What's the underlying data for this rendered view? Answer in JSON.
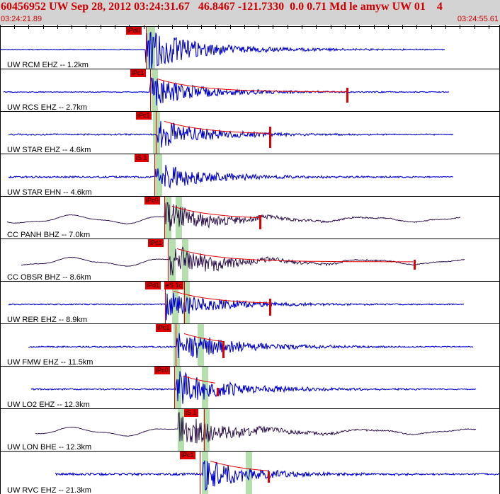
{
  "header": {
    "title": "60456952 UW Sep 28, 2012 03:24:31.67   46.8467 -121.7330  0.0 0.71 Md le amyw UW 01    4",
    "start_time": "03:24:21.89",
    "end_time": "03:24:55.61"
  },
  "colors": {
    "header_bg": "#d3d3d3",
    "header_text": "#cc0000",
    "trace_blue": "#0000cc",
    "trace_dark": "#200040",
    "pick_red": "#e00000",
    "window_green": "#a8dba0"
  },
  "traces": [
    {
      "label": "UW RCM EHZ -- 1.2km",
      "picks": [
        "iPd0"
      ],
      "color": "blue"
    },
    {
      "label": "UW RCS EHZ -- 2.7km",
      "picks": [
        "iPc1"
      ],
      "color": "blue"
    },
    {
      "label": "UW STAR EHZ -- 4.6km",
      "picks": [
        "iPc1"
      ],
      "color": "blue"
    },
    {
      "label": "UW STAR EHN -- 4.6km",
      "picks": [
        "iS 1"
      ],
      "color": "blue"
    },
    {
      "label": "CC PANH BHZ -- 7.0km",
      "picks": [
        "iPc0"
      ],
      "color": "dark"
    },
    {
      "label": "CC OBSR BHZ -- 8.6km",
      "picks": [
        "iPc1"
      ],
      "color": "dark"
    },
    {
      "label": "UW RER EHZ -- 8.9km",
      "picks": [
        "iPd1",
        "eS 1c"
      ],
      "color": "blue"
    },
    {
      "label": "UW FMW EHZ -- 11.5km",
      "picks": [
        "iPc1"
      ],
      "color": "blue"
    },
    {
      "label": "UW LO2 EHZ -- 12.3km",
      "picks": [
        "iPc0"
      ],
      "color": "blue"
    },
    {
      "label": "UW LON BHE -- 12.3km",
      "picks": [
        "iS 1"
      ],
      "color": "dark"
    },
    {
      "label": "UW RVC EHZ -- 21.3km",
      "picks": [
        "iPc1"
      ],
      "color": "blue"
    }
  ]
}
